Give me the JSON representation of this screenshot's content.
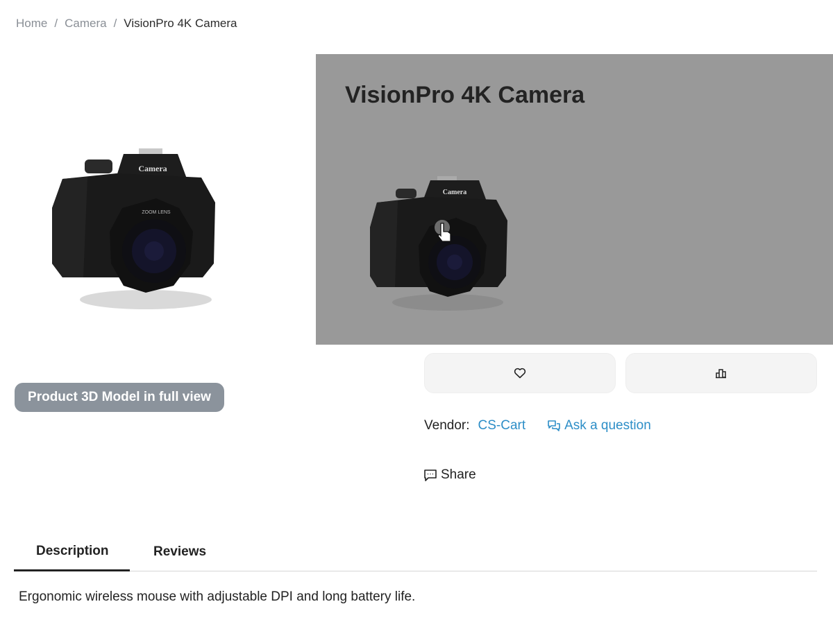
{
  "breadcrumb": {
    "home": "Home",
    "category": "Camera",
    "current": "VisionPro 4K Camera",
    "separator": "/"
  },
  "product": {
    "title": "VisionPro 4K Camera",
    "model_label": "Camera",
    "lens_text": "ZOOM LENS",
    "view_3d_button": "Product 3D Model in full view"
  },
  "actions": {
    "wishlist_icon": "heart-icon",
    "compare_icon": "compare-icon"
  },
  "vendor": {
    "label": "Vendor:",
    "name": "CS-Cart",
    "ask": "Ask a question"
  },
  "share": {
    "label": "Share"
  },
  "tabs": [
    {
      "label": "Description",
      "active": true
    },
    {
      "label": "Reviews",
      "active": false
    }
  ],
  "description": "Ergonomic wireless mouse with adjustable DPI and long battery life.",
  "colors": {
    "link": "#2d8ec7",
    "overlay": "#999999",
    "button_3d": "#8b939c"
  }
}
